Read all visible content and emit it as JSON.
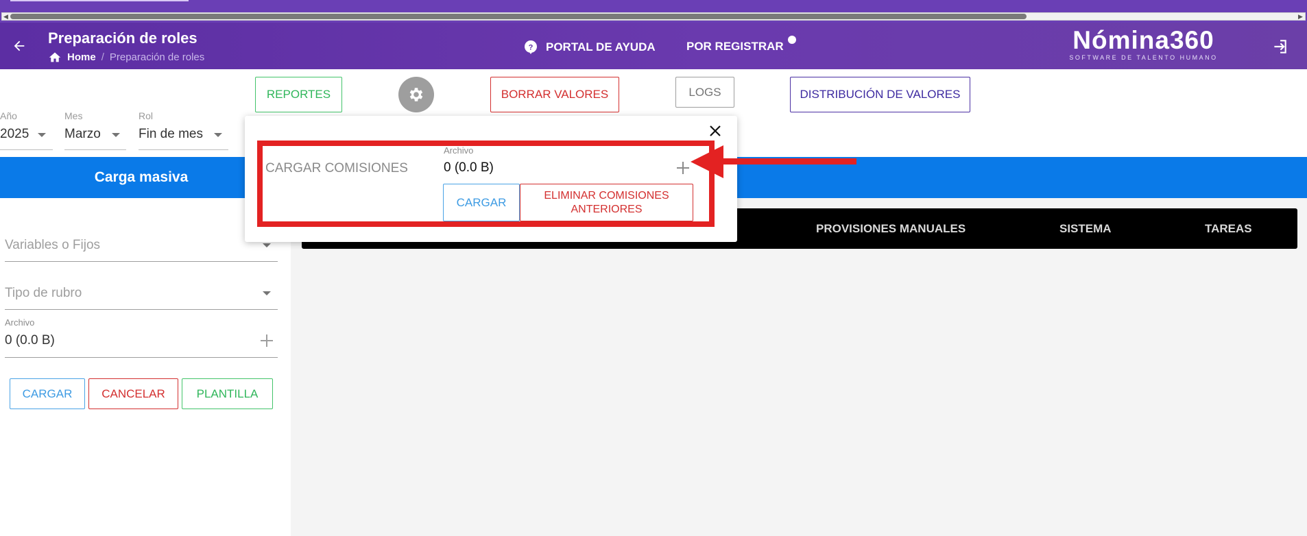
{
  "header": {
    "title": "Preparación de roles",
    "breadcrumb_home": "Home",
    "breadcrumb_sep": "/",
    "breadcrumb_current": "Preparación de roles",
    "help_label": "PORTAL DE AYUDA",
    "register_label": "POR REGISTRAR",
    "logo_main": "Nómina360",
    "logo_sub": "SOFTWARE DE TALENTO HUMANO"
  },
  "toolbar": {
    "reportes": "REPORTES",
    "borrar": "BORRAR VALORES",
    "logs": "LOGS",
    "distribucion": "DISTRIBUCIÓN DE VALORES"
  },
  "filters": {
    "year_label": "Año",
    "year_value": "2025",
    "month_label": "Mes",
    "month_value": "Marzo",
    "role_label": "Rol",
    "role_value": "Fin de mes"
  },
  "bulk": {
    "title": "Carga masiva",
    "variables_placeholder": "Variables o Fijos",
    "tipo_placeholder": "Tipo de rubro",
    "file_label": "Archivo",
    "file_value": "0 (0.0 B)",
    "cargar": "CARGAR",
    "cancelar": "CANCELAR",
    "plantilla": "PLANTILLA"
  },
  "tabs": [
    "PROVISIONES MANUALES",
    "SISTEMA",
    "TAREAS"
  ],
  "popup": {
    "label": "CARGAR COMISIONES",
    "file_label": "Archivo",
    "file_value": "0 (0.0 B)",
    "cargar": "CARGAR",
    "eliminar_line1": "ELIMINAR COMISIONES",
    "eliminar_line2": "ANTERIORES"
  },
  "colors": {
    "header": "#5c2ea3",
    "blue_bar": "#0a7ae8",
    "annotation": "#e32222"
  }
}
